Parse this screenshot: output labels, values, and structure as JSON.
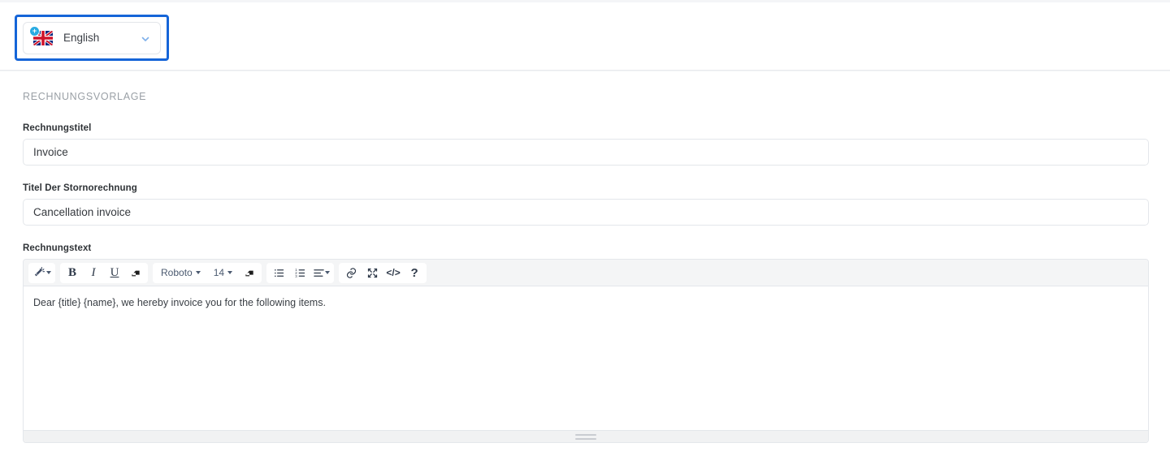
{
  "language_selector": {
    "value": "English",
    "flag_icon": "uk-flag-icon",
    "badge_symbol": "+",
    "chevron_icon": "chevron-down-icon",
    "focus_ring_color": "#1565d8"
  },
  "section": {
    "title": "RECHNUNGSVORLAGE"
  },
  "fields": {
    "invoice_title": {
      "label": "Rechnungstitel",
      "value": "Invoice",
      "placeholder": "Invoice"
    },
    "cancellation_title": {
      "label": "Titel Der Stornorechnung",
      "value": "Cancellation invoice",
      "placeholder": "Cancellation invoice"
    },
    "invoice_text": {
      "label": "Rechnungstext",
      "content": "Dear {title} {name}, we hereby invoice you for the following items."
    }
  },
  "editor_toolbar": {
    "groups": [
      {
        "name": "magic",
        "items": [
          {
            "name": "magic-wand-button",
            "icon": "magic-wand-icon",
            "label": "",
            "has_caret": true
          }
        ]
      },
      {
        "name": "text-style",
        "items": [
          {
            "name": "bold-button",
            "icon": "bold-icon",
            "label": "B",
            "has_caret": false
          },
          {
            "name": "italic-button",
            "icon": "italic-icon",
            "label": "I",
            "has_caret": false
          },
          {
            "name": "underline-button",
            "icon": "underline-icon",
            "label": "U",
            "has_caret": false
          },
          {
            "name": "clear-format-button",
            "icon": "eraser-icon",
            "label": "",
            "has_caret": false
          }
        ]
      },
      {
        "name": "font",
        "items": [
          {
            "name": "font-family-select",
            "icon": "",
            "label": "Roboto",
            "has_caret": true
          },
          {
            "name": "font-size-select",
            "icon": "",
            "label": "14",
            "has_caret": true
          },
          {
            "name": "text-color-button",
            "icon": "ink-icon",
            "label": "",
            "has_caret": false
          }
        ]
      },
      {
        "name": "lists",
        "items": [
          {
            "name": "bullet-list-button",
            "icon": "bullet-list-icon",
            "label": "",
            "has_caret": false
          },
          {
            "name": "numbered-list-button",
            "icon": "numbered-list-icon",
            "label": "",
            "has_caret": false
          },
          {
            "name": "align-button",
            "icon": "align-left-icon",
            "label": "",
            "has_caret": true
          }
        ]
      },
      {
        "name": "insert",
        "items": [
          {
            "name": "insert-link-button",
            "icon": "link-icon",
            "label": "",
            "has_caret": false
          },
          {
            "name": "fullscreen-button",
            "icon": "fullscreen-icon",
            "label": "",
            "has_caret": false
          },
          {
            "name": "source-code-button",
            "icon": "code-icon",
            "label": "</>",
            "has_caret": false
          },
          {
            "name": "help-button",
            "icon": "question-mark-icon",
            "label": "?",
            "has_caret": false
          }
        ]
      }
    ]
  },
  "editor_footer": {
    "resize_handle": "resize-grip-handle"
  }
}
